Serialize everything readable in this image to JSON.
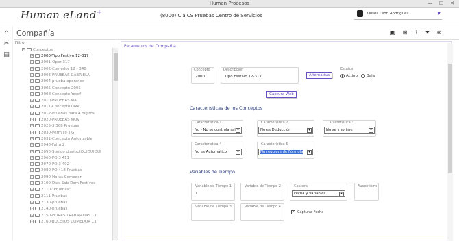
{
  "window": {
    "title": "Human Procesos",
    "minimize": "—",
    "maximize": "☐",
    "close": "✕"
  },
  "header": {
    "logo": "Human eLand",
    "logo_plus": "+",
    "company": "(8000) Cia  CS  Pruebas Centro de Servicios",
    "user": "Ulises Leon Rodriguez"
  },
  "page": {
    "title": "Compañía"
  },
  "tree": {
    "filter_label": "Filtro",
    "root": "Conceptos",
    "items": [
      "2000-Tipo Festivo 12-317",
      "2001-Oper 317",
      "2002-Comedor 12 - 346",
      "2003-PRUEBAS GABRIELA",
      "2004-prueba operando",
      "2005-Concepto 2005",
      "2008-Concepto Yosef",
      "2010-PRUEBAS MAC",
      "2011-Concepto UMA",
      "2012-Pruebas para 4 digitos",
      "2020-PRUEBAS MOV",
      "2025-3 368 Pruebas",
      "2030-Permiso s G",
      "2031-Concepto Autorizable",
      "2040-Falta 2",
      "2050-Sueldo diarioUIOUIOUIOUI",
      "2060-PO 3 411",
      "2070-PO 3 492",
      "2080-PO 418 Pruebas",
      "2090-Horas Comedor",
      "2100-Dias Sab-Dom Festivos",
      "2110-\"Pruebas\"",
      "2111-Pruebas",
      "2130-pruebas",
      "2140-pruebas",
      "2150-HORAS TRABAJADAS CT",
      "2160-BOLETOS COMEDOR CT"
    ],
    "selected_index": 0
  },
  "form": {
    "panel_title": "Parámetros de Compañía",
    "concepto_label": "Concepto",
    "concepto_value": "2000",
    "descripcion_label": "Descripción",
    "descripcion_value": "Tipo Festivo 12-317",
    "alternativa_btn": "Alternativa",
    "estatus_label": "Estatus",
    "activo_label": "Activo",
    "baja_label": "Baja",
    "captura_web_btn": "Captura Web",
    "caracteristicas_title": "Características de los Conceptos",
    "car1_label": "Característica 1",
    "car1_value": "No - No se controla saldo",
    "car2_label": "Característica 2",
    "car2_value": "No es Deducción",
    "car3_label": "Característica 3",
    "car3_value": "No se imprime",
    "car4_label": "Característica 4",
    "car4_value": "No es Automático",
    "car5_label": "Característica 5",
    "car5_value": "No requiere de Fórmula",
    "variables_title": "Variables de Tiempo",
    "vt1_label": "Variable de Tiempo 1",
    "vt1_value": "1",
    "vt2_label": "Variable de Tiempo 2",
    "captura_label": "Captura",
    "captura_value": "Fecha y Variables",
    "ausentismo_label": "Ausentismo",
    "vt3_label": "Variable de Tiempo 3",
    "vt4_label": "Variable de Tiempo 4",
    "capturar_fecha_label": "Capturar Fecha"
  },
  "icons": {
    "home": "⌂",
    "tools": "✂",
    "report": "▤",
    "save": "▣",
    "delete": "⊠",
    "export": "⇪",
    "filter": "⏷",
    "close": "⊗",
    "dropdown": "▾",
    "check": "✓"
  },
  "colors": {
    "accent": "#6a4fc2",
    "section": "#2c3e7a",
    "highlight": "#3a6fd8"
  }
}
